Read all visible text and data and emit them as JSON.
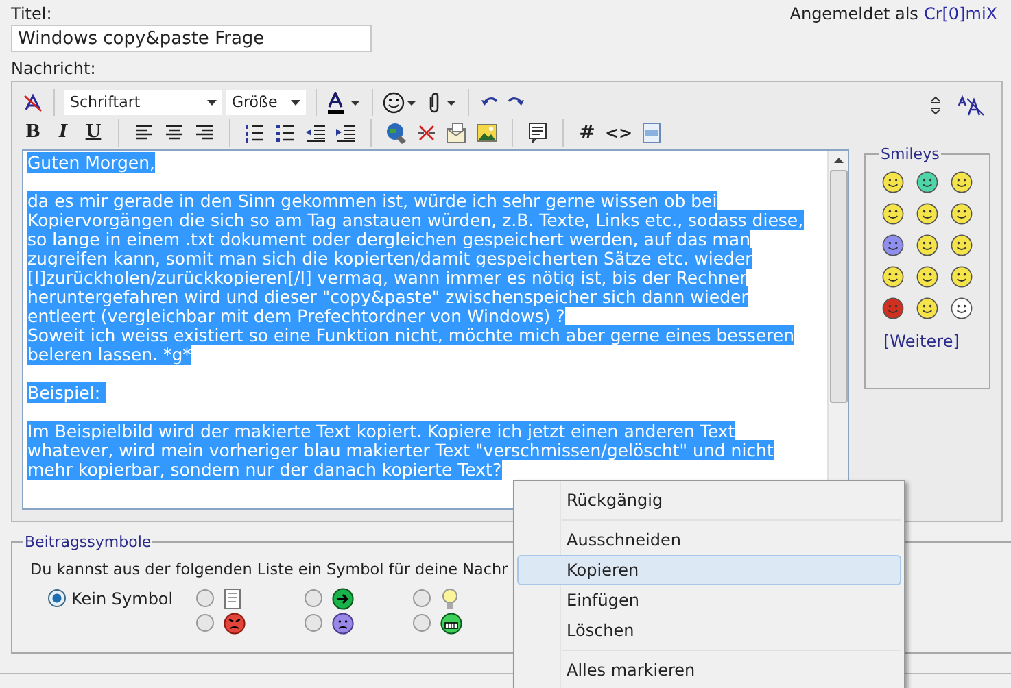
{
  "title_field": {
    "label": "Titel:",
    "value": "Windows copy&paste Frage"
  },
  "login": {
    "prefix": "Angemeldet als",
    "user": "Cr[0]miX"
  },
  "message_label": "Nachricht:",
  "toolbar": {
    "font_select": "Schriftart",
    "size_select": "Größe",
    "bold": "B",
    "italic": "I",
    "underline": "U",
    "hash": "#",
    "code": "<>"
  },
  "message": {
    "paragraphs": [
      {
        "lines": [
          "Guten Morgen,"
        ]
      },
      {
        "lines": [
          "da es mir gerade in den Sinn gekommen ist, würde ich sehr gerne wissen ob bei",
          "Kopiervorgängen die sich so am Tag anstauen würden, z.B. Texte, Links etc., sodass diese,",
          "so lange in einem .txt dokument oder dergleichen gespeichert werden, auf das man",
          "zugreifen kann, somit man sich die kopierten/damit gespeicherten Sätze etc. wieder",
          "[I]zurückholen/zurückkopieren[/I] vermag, wann immer es nötig ist, bis der Rechner",
          "heruntergefahren wird und dieser \"copy&paste\" zwischenspeicher sich dann wieder",
          "entleert (vergleichbar mit dem Prefechtordner von Windows) ?",
          "Soweit ich weiss existiert so eine Funktion nicht, möchte mich aber gerne eines besseren",
          "beleren lassen. *g*"
        ]
      },
      {
        "lines": [
          "Beispiel: "
        ]
      },
      {
        "lines": [
          "Im Beispielbild wird der makierte Text kopiert. Kopiere ich jetzt einen anderen Text",
          "whatever, wird mein vorheriger blau makierter Text \"verschmissen/gelöscht\" und nicht",
          "mehr kopierbar, sondern nur der danach kopierte Text?"
        ]
      }
    ],
    "selected": true
  },
  "smileys": {
    "title": "Smileys",
    "more": "[Weitere]",
    "items": [
      {
        "color": "#f5e34a"
      },
      {
        "color": "#4fd6a8"
      },
      {
        "color": "#f5e34a"
      },
      {
        "color": "#f5e34a"
      },
      {
        "color": "#f5e34a"
      },
      {
        "color": "#f5e34a"
      },
      {
        "color": "#8f8ff0"
      },
      {
        "color": "#f5e34a"
      },
      {
        "color": "#f5e34a"
      },
      {
        "color": "#f5e34a"
      },
      {
        "color": "#f5e34a"
      },
      {
        "color": "#f5e34a"
      },
      {
        "color": "#d03020"
      },
      {
        "color": "#f5e34a"
      },
      {
        "color": "#ffffff"
      }
    ]
  },
  "post_icons": {
    "title": "Beitragssymbole",
    "intro": "Du kannst aus der folgenden Liste ein Symbol für deine Nachr",
    "none_label": "Kein Symbol",
    "none_selected": true,
    "columns": [
      [
        {
          "kind": "document",
          "selected": false
        },
        {
          "kind": "angry",
          "selected": false
        }
      ],
      [
        {
          "kind": "arrow",
          "selected": false
        },
        {
          "kind": "sad",
          "selected": false
        }
      ],
      [
        {
          "kind": "bulb",
          "selected": false
        },
        {
          "kind": "grin",
          "selected": false
        }
      ]
    ]
  },
  "context_menu": [
    {
      "kind": "item",
      "label": "Rückgängig",
      "selected": false
    },
    {
      "kind": "separator"
    },
    {
      "kind": "item",
      "label": "Ausschneiden",
      "selected": false
    },
    {
      "kind": "item",
      "label": "Kopieren",
      "selected": true
    },
    {
      "kind": "item",
      "label": "Einfügen",
      "selected": false
    },
    {
      "kind": "item",
      "label": "Löschen",
      "selected": false
    },
    {
      "kind": "separator"
    },
    {
      "kind": "item",
      "label": "Alles markieren",
      "selected": false
    }
  ]
}
